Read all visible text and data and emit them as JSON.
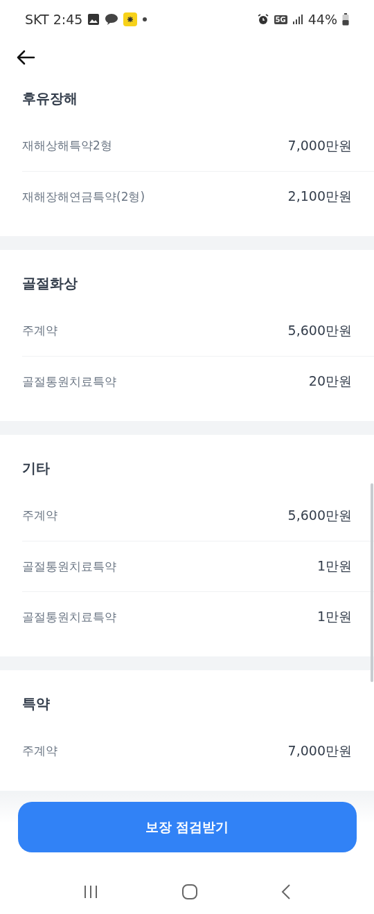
{
  "status_bar": {
    "carrier_time": "SKT 2:45",
    "network": "5G",
    "battery": "44%"
  },
  "sections": [
    {
      "title": "후유장해",
      "rows": [
        {
          "label": "재해상해특약2형",
          "amount": "7,000만원"
        },
        {
          "label": "재해장해연금특약(2형)",
          "amount": "2,100만원"
        }
      ]
    },
    {
      "title": "골절화상",
      "rows": [
        {
          "label": "주계약",
          "amount": "5,600만원"
        },
        {
          "label": "골절통원치료특약",
          "amount": "20만원"
        }
      ]
    },
    {
      "title": "기타",
      "rows": [
        {
          "label": "주계약",
          "amount": "5,600만원"
        },
        {
          "label": "골절통원치료특약",
          "amount": "1만원"
        },
        {
          "label": "골절통원치료특약",
          "amount": "1만원"
        }
      ]
    },
    {
      "title": "특약",
      "rows": [
        {
          "label": "주계약",
          "amount": "7,000만원"
        }
      ]
    }
  ],
  "cta_button": "보장 점검받기"
}
